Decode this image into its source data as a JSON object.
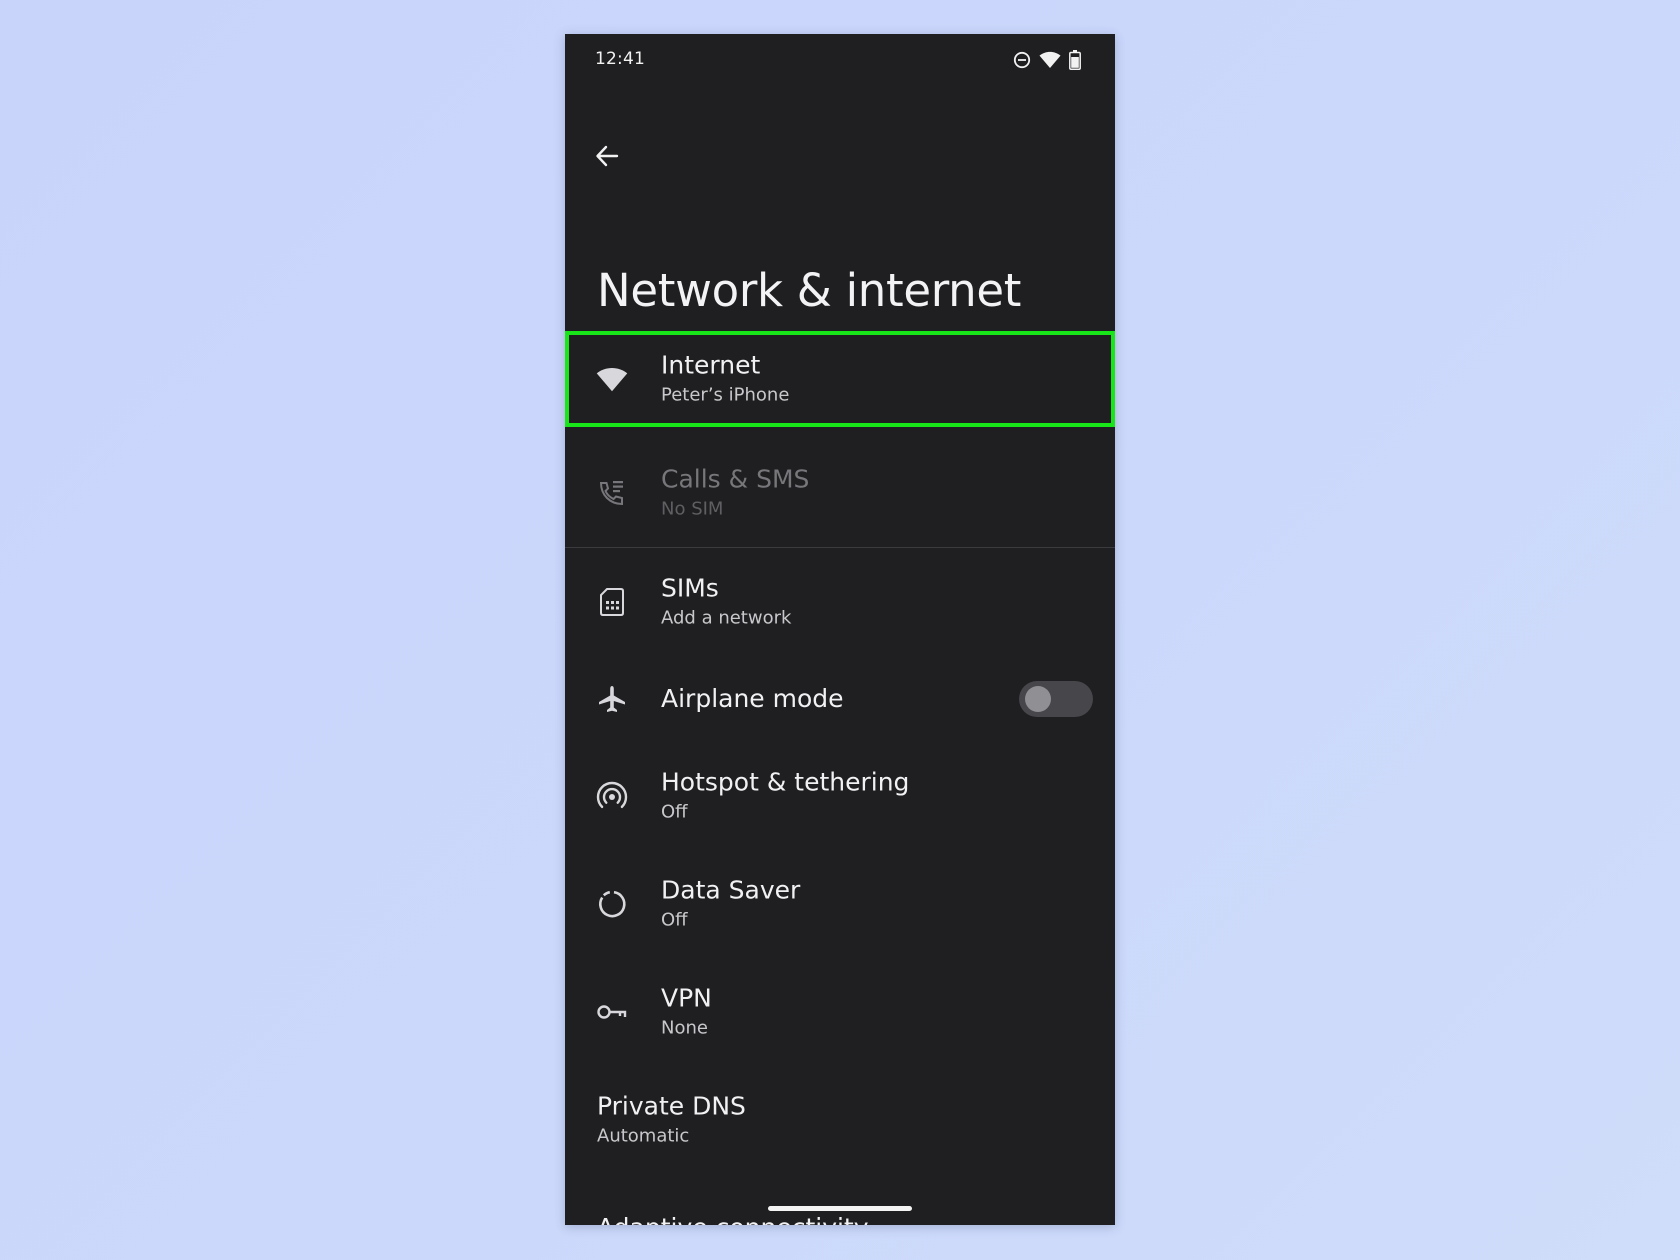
{
  "status_bar": {
    "time": "12:41",
    "icons": [
      "do-not-disturb-icon",
      "wifi-icon",
      "battery-icon"
    ]
  },
  "header": {
    "back_icon": "arrow-left-icon",
    "title": "Network & internet"
  },
  "items": [
    {
      "id": "internet",
      "icon": "wifi-icon",
      "title": "Internet",
      "subtitle": "Peter’s iPhone",
      "highlighted": true,
      "enabled": true
    },
    {
      "id": "calls-sms",
      "icon": "phone-call-icon",
      "title": "Calls & SMS",
      "subtitle": "No SIM",
      "enabled": false
    },
    {
      "id": "sims",
      "icon": "sim-card-icon",
      "title": "SIMs",
      "subtitle": "Add a network",
      "enabled": true
    },
    {
      "id": "airplane",
      "icon": "airplane-icon",
      "title": "Airplane mode",
      "toggle": false,
      "enabled": true
    },
    {
      "id": "hotspot",
      "icon": "hotspot-icon",
      "title": "Hotspot & tethering",
      "subtitle": "Off",
      "enabled": true
    },
    {
      "id": "data-saver",
      "icon": "data-saver-icon",
      "title": "Data Saver",
      "subtitle": "Off",
      "enabled": true
    },
    {
      "id": "vpn",
      "icon": "key-icon",
      "title": "VPN",
      "subtitle": "None",
      "enabled": true
    },
    {
      "id": "private-dns",
      "title": "Private DNS",
      "subtitle": "Automatic",
      "enabled": true
    },
    {
      "id": "adaptive",
      "title": "Adaptive connectivity",
      "enabled": true
    }
  ],
  "colors": {
    "background": "#cbd7fb",
    "screen": "#1f1f21",
    "highlight": "#19e619",
    "text": "#f1f1f3",
    "subtext": "#c8c8cc"
  }
}
